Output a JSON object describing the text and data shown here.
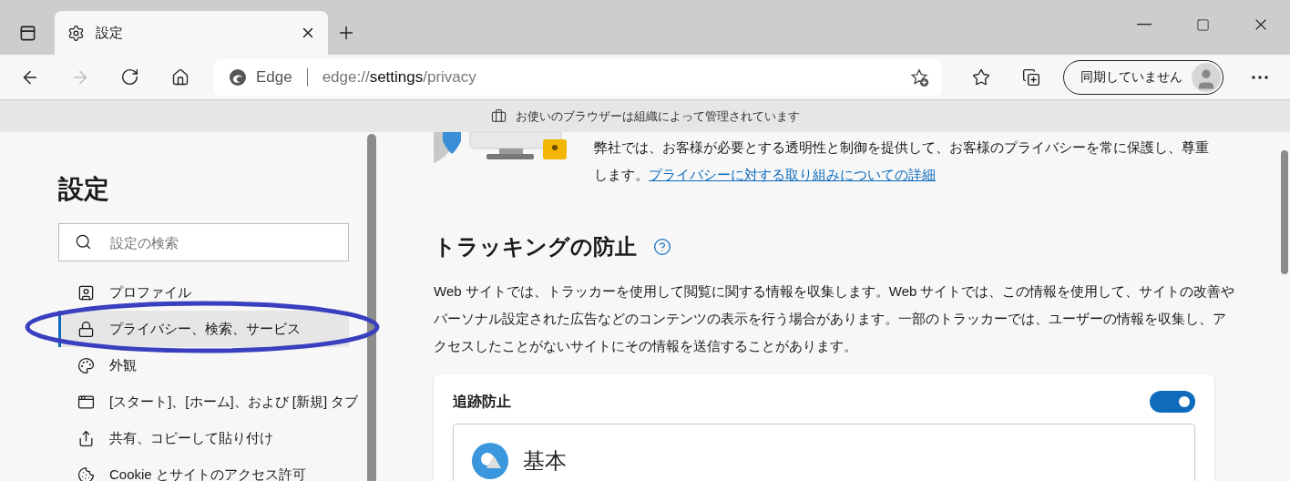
{
  "tabs": [
    {
      "title": "設定",
      "selected": true
    }
  ],
  "address": {
    "brand": "Edge",
    "url_scheme": "edge://",
    "url_host": "settings",
    "url_path": "/privacy"
  },
  "profile_button": "同期していません",
  "managed_notice": "お使いのブラウザーは組織によって管理されています",
  "sidebar": {
    "title": "設定",
    "search": {
      "placeholder": "設定の検索"
    },
    "items": [
      {
        "label": "プロファイル",
        "kind": "profile",
        "selected": false
      },
      {
        "label": "プライバシー、検索、サービス",
        "kind": "privacy",
        "selected": true
      },
      {
        "label": "外観",
        "kind": "appearance",
        "selected": false
      },
      {
        "label": "[スタート]、[ホーム]、および [新規] タブ",
        "kind": "newtab",
        "selected": false
      },
      {
        "label": "共有、コピーして貼り付け",
        "kind": "share",
        "selected": false
      },
      {
        "label": "Cookie とサイトのアクセス許可",
        "kind": "cookies",
        "selected": false
      }
    ]
  },
  "highlight_ellipse": true,
  "intro": {
    "text": "弊社では、お客様が必要とする透明性と制御を提供して、お客様のプライバシーを常に保護し、尊重します。",
    "link": "プライバシーに対する取り組みについての詳細"
  },
  "tracking": {
    "title": "トラッキングの防止",
    "description": "Web サイトでは、トラッカーを使用して閲覧に関する情報を収集します。Web サイトでは、この情報を使用して、サイトの改善やパーソナル設定された広告などのコンテンツの表示を行う場合があります。一部のトラッカーでは、ユーザーの情報を収集し、アクセスしたことがないサイトにその情報を送信することがあります。",
    "card": {
      "title": "追跡防止",
      "on": true,
      "option": {
        "title": "基本"
      }
    }
  }
}
